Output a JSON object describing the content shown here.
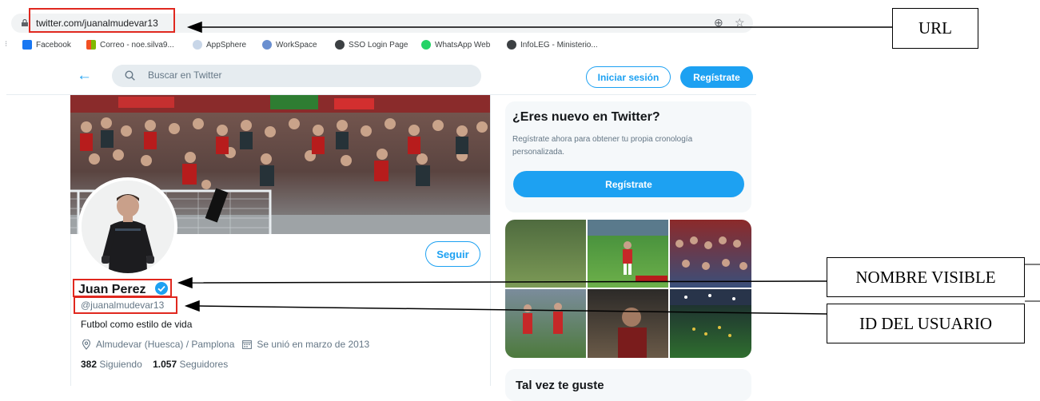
{
  "browser": {
    "url": "twitter.com/juanalmudevar13",
    "bookmarks": [
      {
        "label": "Facebook",
        "color": "#1877f2"
      },
      {
        "label": "Correo - noe.silva9...",
        "color": "#f25022"
      },
      {
        "label": "AppSphere",
        "color": "#8aa6c8"
      },
      {
        "label": "WorkSpace",
        "color": "#6a8fd0"
      },
      {
        "label": "SSO Login Page",
        "color": "#3c4043"
      },
      {
        "label": "WhatsApp Web",
        "color": "#25d366"
      },
      {
        "label": "InfoLEG - Ministerio...",
        "color": "#3c4043"
      }
    ]
  },
  "twitter_header": {
    "search_placeholder": "Buscar en Twitter",
    "login_label": "Iniciar sesión",
    "register_label": "Regístrate"
  },
  "profile": {
    "name": "Juan Perez",
    "handle": "@juanalmudevar13",
    "bio": "Futbol como estilo de vida",
    "location": "Almudevar (Huesca) / Pamplona",
    "joined": "Se unió en marzo de 2013",
    "following_count": "382",
    "following_label": "Siguiendo",
    "followers_count": "1.057",
    "followers_label": "Seguidores",
    "follow_label": "Seguir"
  },
  "sidebar": {
    "signup_title": "¿Eres nuevo en Twitter?",
    "signup_text": "Regístrate ahora para obtener tu propia cronología personalizada.",
    "signup_button": "Regístrate",
    "next_card_title": "Tal vez te guste"
  },
  "annotations": {
    "url": "URL",
    "name": "NOMBRE VISIBLE",
    "id": "ID DEL USUARIO"
  },
  "colors": {
    "twitter_blue": "#1da1f2",
    "highlight_red": "#e0281f"
  }
}
